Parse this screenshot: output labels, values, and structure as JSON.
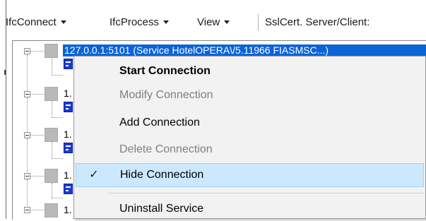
{
  "menubar": {
    "items": [
      {
        "label": "IfcConnect",
        "has_dropdown": true
      },
      {
        "label": "IfcProcess",
        "has_dropdown": true
      },
      {
        "label": "View",
        "has_dropdown": true
      }
    ],
    "ssl_label": "SslCert. Server/Client:"
  },
  "tree": {
    "selected_node_label": "127.0.0.1:5101 (Service HotelOPERA\\/5.11966 FIASMSC...)",
    "rows": [
      {
        "label": "1."
      },
      {
        "label": "1."
      },
      {
        "label": "1."
      },
      {
        "label": "1."
      }
    ]
  },
  "context_menu": {
    "items": [
      {
        "label": "Start Connection",
        "enabled": true,
        "default": true,
        "checked": false,
        "highlighted": false
      },
      {
        "label": "Modify Connection",
        "enabled": false,
        "default": false,
        "checked": false,
        "highlighted": false
      },
      {
        "label": "Add Connection",
        "enabled": true,
        "default": false,
        "checked": false,
        "highlighted": false
      },
      {
        "label": "Delete Connection",
        "enabled": false,
        "default": false,
        "checked": false,
        "highlighted": false
      },
      {
        "label": "Hide Connection",
        "enabled": true,
        "default": false,
        "checked": true,
        "highlighted": true
      },
      {
        "label": "Uninstall Service",
        "enabled": true,
        "default": false,
        "checked": false,
        "highlighted": false
      }
    ],
    "check_glyph": "✓"
  },
  "colors": {
    "selection": "#0a64d8",
    "menu_background": "#f2f2f2",
    "hover_background": "#cce8ff",
    "hover_border": "#99d1ff",
    "disabled_text": "#7f7f7f",
    "connection_icon": "#1b3bd6"
  },
  "icons": {
    "expander": "tree-collapse-minus-icon",
    "node": "service-node-icon",
    "connection": "connection-icon",
    "check": "checkmark-icon",
    "dropdown": "caret-down-icon"
  }
}
